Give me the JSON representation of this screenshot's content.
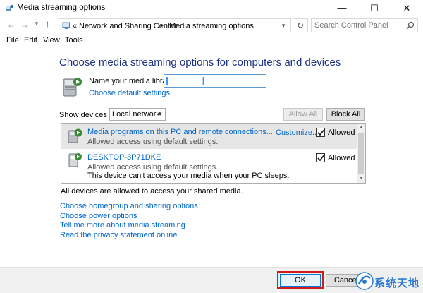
{
  "window": {
    "title": "Media streaming options",
    "minimize_glyph": "—",
    "maximize_glyph": "☐",
    "close_glyph": "✕"
  },
  "nav": {
    "back_glyph": "←",
    "forward_glyph": "→",
    "up_glyph": "↑",
    "breadcrumb_prefix": "«",
    "breadcrumbs": [
      "Network and Sharing Center",
      "Media streaming options"
    ],
    "separator": "›",
    "search_placeholder": "Search Control Panel"
  },
  "menu": {
    "file": "File",
    "edit": "Edit",
    "view": "View",
    "tools": "Tools"
  },
  "main": {
    "heading": "Choose media streaming options for computers and devices",
    "library_label": "Name your media library:",
    "library_value": "███████",
    "choose_default_link": "Choose default settings...",
    "show_devices_label": "Show devices on:",
    "show_devices_value": "Local network",
    "allow_all_button": "Allow All",
    "block_all_button": "Block All"
  },
  "devices": [
    {
      "name": "Media programs on this PC and remote connections...",
      "status": "Allowed access using default settings.",
      "note": "",
      "customize": "Customize...",
      "checked": true,
      "allowed_label": "Allowed"
    },
    {
      "name": "DESKTOP-3P71DKE",
      "status": "Allowed access using default settings.",
      "note": "This device can't access your media when your PC sleeps.",
      "customize": "",
      "checked": true,
      "allowed_label": "Allowed"
    }
  ],
  "status_text": "All devices are allowed to access your shared media.",
  "links": [
    "Choose homegroup and sharing options",
    "Choose power options",
    "Tell me more about media streaming",
    "Read the privacy statement online"
  ],
  "footer": {
    "ok_button": "OK",
    "cancel_button": "Cancel",
    "highlight_color": "#d11a1a"
  },
  "watermark": {
    "text": "系统天地"
  },
  "colors": {
    "heading": "#1e3287",
    "link": "#0066cc",
    "selected_row": "#e6e6e6"
  }
}
